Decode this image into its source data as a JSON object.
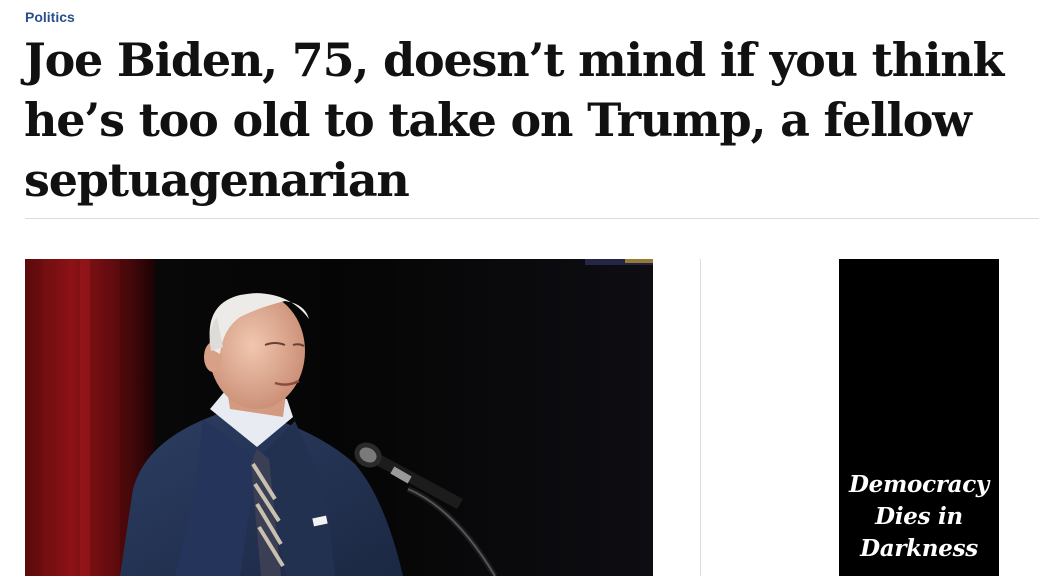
{
  "article": {
    "section": "Politics",
    "headline": "Joe Biden, 75, doesn’t mind if you think he’s too old to take on Trump, a fellow septuagenarian"
  },
  "promo": {
    "line1": "Democracy",
    "line2": "Dies in",
    "line3": "Darkness"
  },
  "colors": {
    "section_link": "#2a4f8c",
    "headline": "#111111",
    "rule": "#dcdcdc",
    "promo_bg": "#000000"
  }
}
